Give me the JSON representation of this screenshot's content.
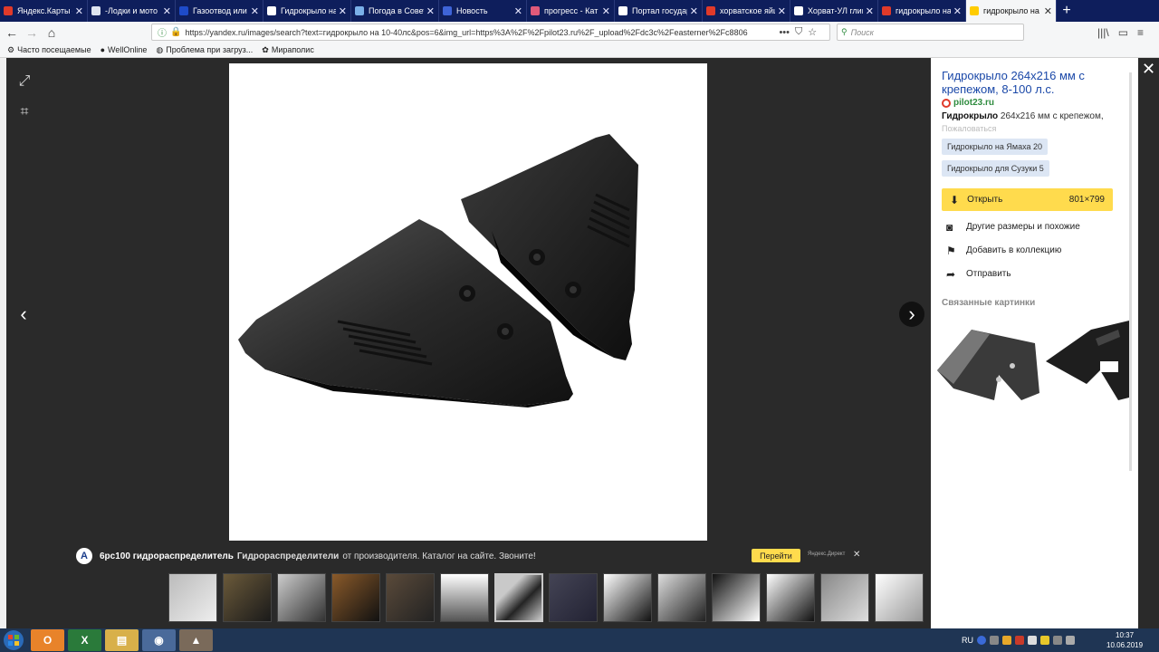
{
  "tabs": [
    {
      "label": "Яндекс.Карты —",
      "icon": "map-pin-icon",
      "color": "#e03a2a"
    },
    {
      "label": "-Лодки и мото",
      "icon": "forum-icon",
      "color": "#dde4f0"
    },
    {
      "label": "Газоотвод или",
      "icon": "site-sm-icon",
      "color": "#1e4bc8"
    },
    {
      "label": "Гидрокрыло на",
      "icon": "page-icon",
      "color": "#ffffff"
    },
    {
      "label": "Погода в Совет",
      "icon": "weather-icon",
      "color": "#7ab0e8"
    },
    {
      "label": "Новость",
      "icon": "news-icon",
      "color": "#3e64d8"
    },
    {
      "label": "прогресс - Кат",
      "icon": "dots-icon",
      "color": "#e05a7a"
    },
    {
      "label": "Портал государ",
      "icon": "flag-icon",
      "color": "#ffffff"
    },
    {
      "label": "хорватское яйц",
      "icon": "yandex-icon",
      "color": "#e03a2a"
    },
    {
      "label": "Хорват-УЛ глиг",
      "icon": "page-icon",
      "color": "#ffffff"
    },
    {
      "label": "гидрокрыло на",
      "icon": "yandex-icon",
      "color": "#e03a2a"
    },
    {
      "label": "гидрокрыло на",
      "icon": "image-icon",
      "color": "#ffcc00",
      "active": true
    }
  ],
  "newtab_label": "+",
  "tab_close": "✕",
  "nav": {
    "back": "←",
    "forward": "→",
    "home": "⌂",
    "url": "https://yandex.ru/images/search?text=гидрокрыло на 10-40лс&pos=6&img_url=https%3A%2F%2Fpilot23.ru%2F_upload%2Fdc3c%2Feasterner%2Fc8806",
    "more": "•••",
    "pocket": "⛉",
    "star": "☆",
    "search_placeholder": "Поиск",
    "library": "|||\\",
    "sidebar": "▭",
    "menu": "≡"
  },
  "bookmarks": [
    {
      "label": "Часто посещаемые",
      "icon": "gear-icon",
      "glyph": "⚙"
    },
    {
      "label": "WellOnline",
      "icon": "globe-icon",
      "glyph": "●"
    },
    {
      "label": "Проблема при загруз...",
      "icon": "globe-icon",
      "glyph": "◍"
    },
    {
      "label": "Мираполис",
      "icon": "mirapolis-icon",
      "glyph": "✿"
    }
  ],
  "viewer": {
    "expand_icon": "⤢",
    "crop_icon": "⌗",
    "prev_arrow": "‹",
    "next_arrow": "›"
  },
  "ad": {
    "logo": "А",
    "title": "6рс100 гидрораспределитель",
    "bold": "Гидрораспределители",
    "text": "от производителя. Каталог на сайте. Звоните!",
    "button": "Перейти",
    "source": "Яндекс.Директ",
    "close": "✕"
  },
  "panel": {
    "title": "Гидрокрыло 264х216 мм с крепежом, 8-100 л.с.",
    "site": "pilot23.ru",
    "desc_bold": "Гидрокрыло",
    "desc": "264х216 мм с крепежом,",
    "complain": "Пожаловаться",
    "tags": [
      "Гидрокрыло на Ямаха 20",
      "Гидрокрыло для Сузуки 5"
    ],
    "open_label": "Открыть",
    "open_icon": "⬇",
    "size": "801×799",
    "actions": [
      {
        "label": "Другие размеры и похожие",
        "icon": "camera-icon",
        "glyph": "◙"
      },
      {
        "label": "Добавить в коллекцию",
        "icon": "bookmark-icon",
        "glyph": "⚑"
      },
      {
        "label": "Отправить",
        "icon": "share-icon",
        "glyph": "➦"
      }
    ],
    "related_heading": "Связанные картинки"
  },
  "close_viewer": "✕",
  "taskbar": {
    "lang": "RU",
    "time": "10:37",
    "date": "10.06.2019"
  },
  "colors": {
    "tabbar": "#0e1e5c",
    "accent_yellow": "#ffdb4d",
    "link_blue": "#1a48a8",
    "site_green": "#2e8b3e"
  }
}
